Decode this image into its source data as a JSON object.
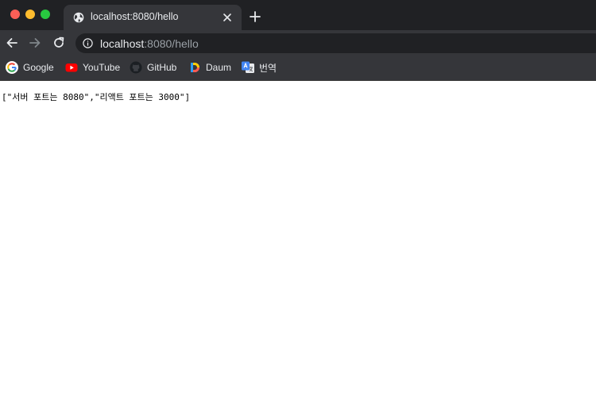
{
  "tab": {
    "title": "localhost:8080/hello"
  },
  "address_bar": {
    "host": "localhost",
    "path": ":8080/hello"
  },
  "bookmarks": [
    {
      "label": "Google",
      "icon": "google-icon"
    },
    {
      "label": "YouTube",
      "icon": "youtube-icon"
    },
    {
      "label": "GitHub",
      "icon": "github-icon"
    },
    {
      "label": "Daum",
      "icon": "daum-icon"
    },
    {
      "label": "번역",
      "icon": "translate-icon"
    }
  ],
  "page": {
    "body_text": "[\"서버 포트는 8080\",\"리액트 포트는 3000\"]"
  },
  "colors": {
    "tabstrip_bg": "#202124",
    "toolbar_bg": "#35363a",
    "omnibox_bg": "#202124",
    "text_light": "#e8eaed",
    "text_dim": "#9aa0a6",
    "traffic_close": "#fe5f57",
    "traffic_minimize": "#febc2e",
    "traffic_maximize": "#28c840"
  }
}
